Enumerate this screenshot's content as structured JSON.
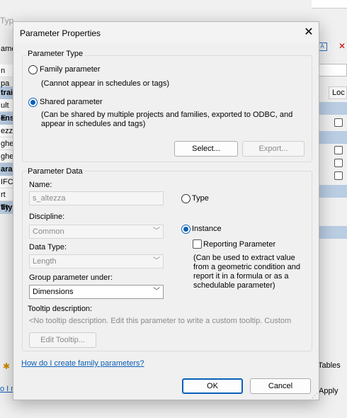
{
  "background": {
    "window_title_fragment": "Types",
    "left_strip": [
      "ame",
      "",
      "n pa",
      "",
      "trai",
      "ult E",
      "ensi",
      "ezza",
      "ghez",
      "ghe",
      "aran",
      "IFC",
      "rt Ty",
      "tity"
    ],
    "right_column_header": "Loc",
    "right_bottom_fragment": "p Tables",
    "apply_fragment": "Apply",
    "link_fragment": "o I m"
  },
  "dialog": {
    "title": "Parameter Properties",
    "parameter_type": {
      "legend": "Parameter Type",
      "family_label": "Family parameter",
      "family_note": "(Cannot appear in schedules or tags)",
      "shared_label": "Shared parameter",
      "shared_note_line1": "(Can be shared by multiple projects and families, exported to ODBC, and",
      "shared_note_line2": "appear in schedules and tags)",
      "selected": "shared",
      "select_button": "Select...",
      "export_button": "Export..."
    },
    "parameter_data": {
      "legend": "Parameter Data",
      "name_label": "Name:",
      "name_value": "s_altezza",
      "discipline_label": "Discipline:",
      "discipline_value": "Common",
      "data_type_label": "Data Type:",
      "data_type_value": "Length",
      "group_label": "Group parameter under:",
      "group_value": "Dimensions",
      "type_label": "Type",
      "instance_label": "Instance",
      "selected": "instance",
      "reporting_label": "Reporting Parameter",
      "reporting_note_1": "(Can be used to extract value",
      "reporting_note_2": "from a geometric condition and",
      "reporting_note_3": "report it in a formula or as a",
      "reporting_note_4": "schedulable parameter)",
      "tooltip_label": "Tooltip description:",
      "tooltip_text": "<No tooltip description. Edit this parameter to write a custom tooltip. Custom",
      "edit_tooltip_button": "Edit Tooltip..."
    },
    "help_link": "How do I create family parameters?",
    "ok_button": "OK",
    "cancel_button": "Cancel"
  }
}
